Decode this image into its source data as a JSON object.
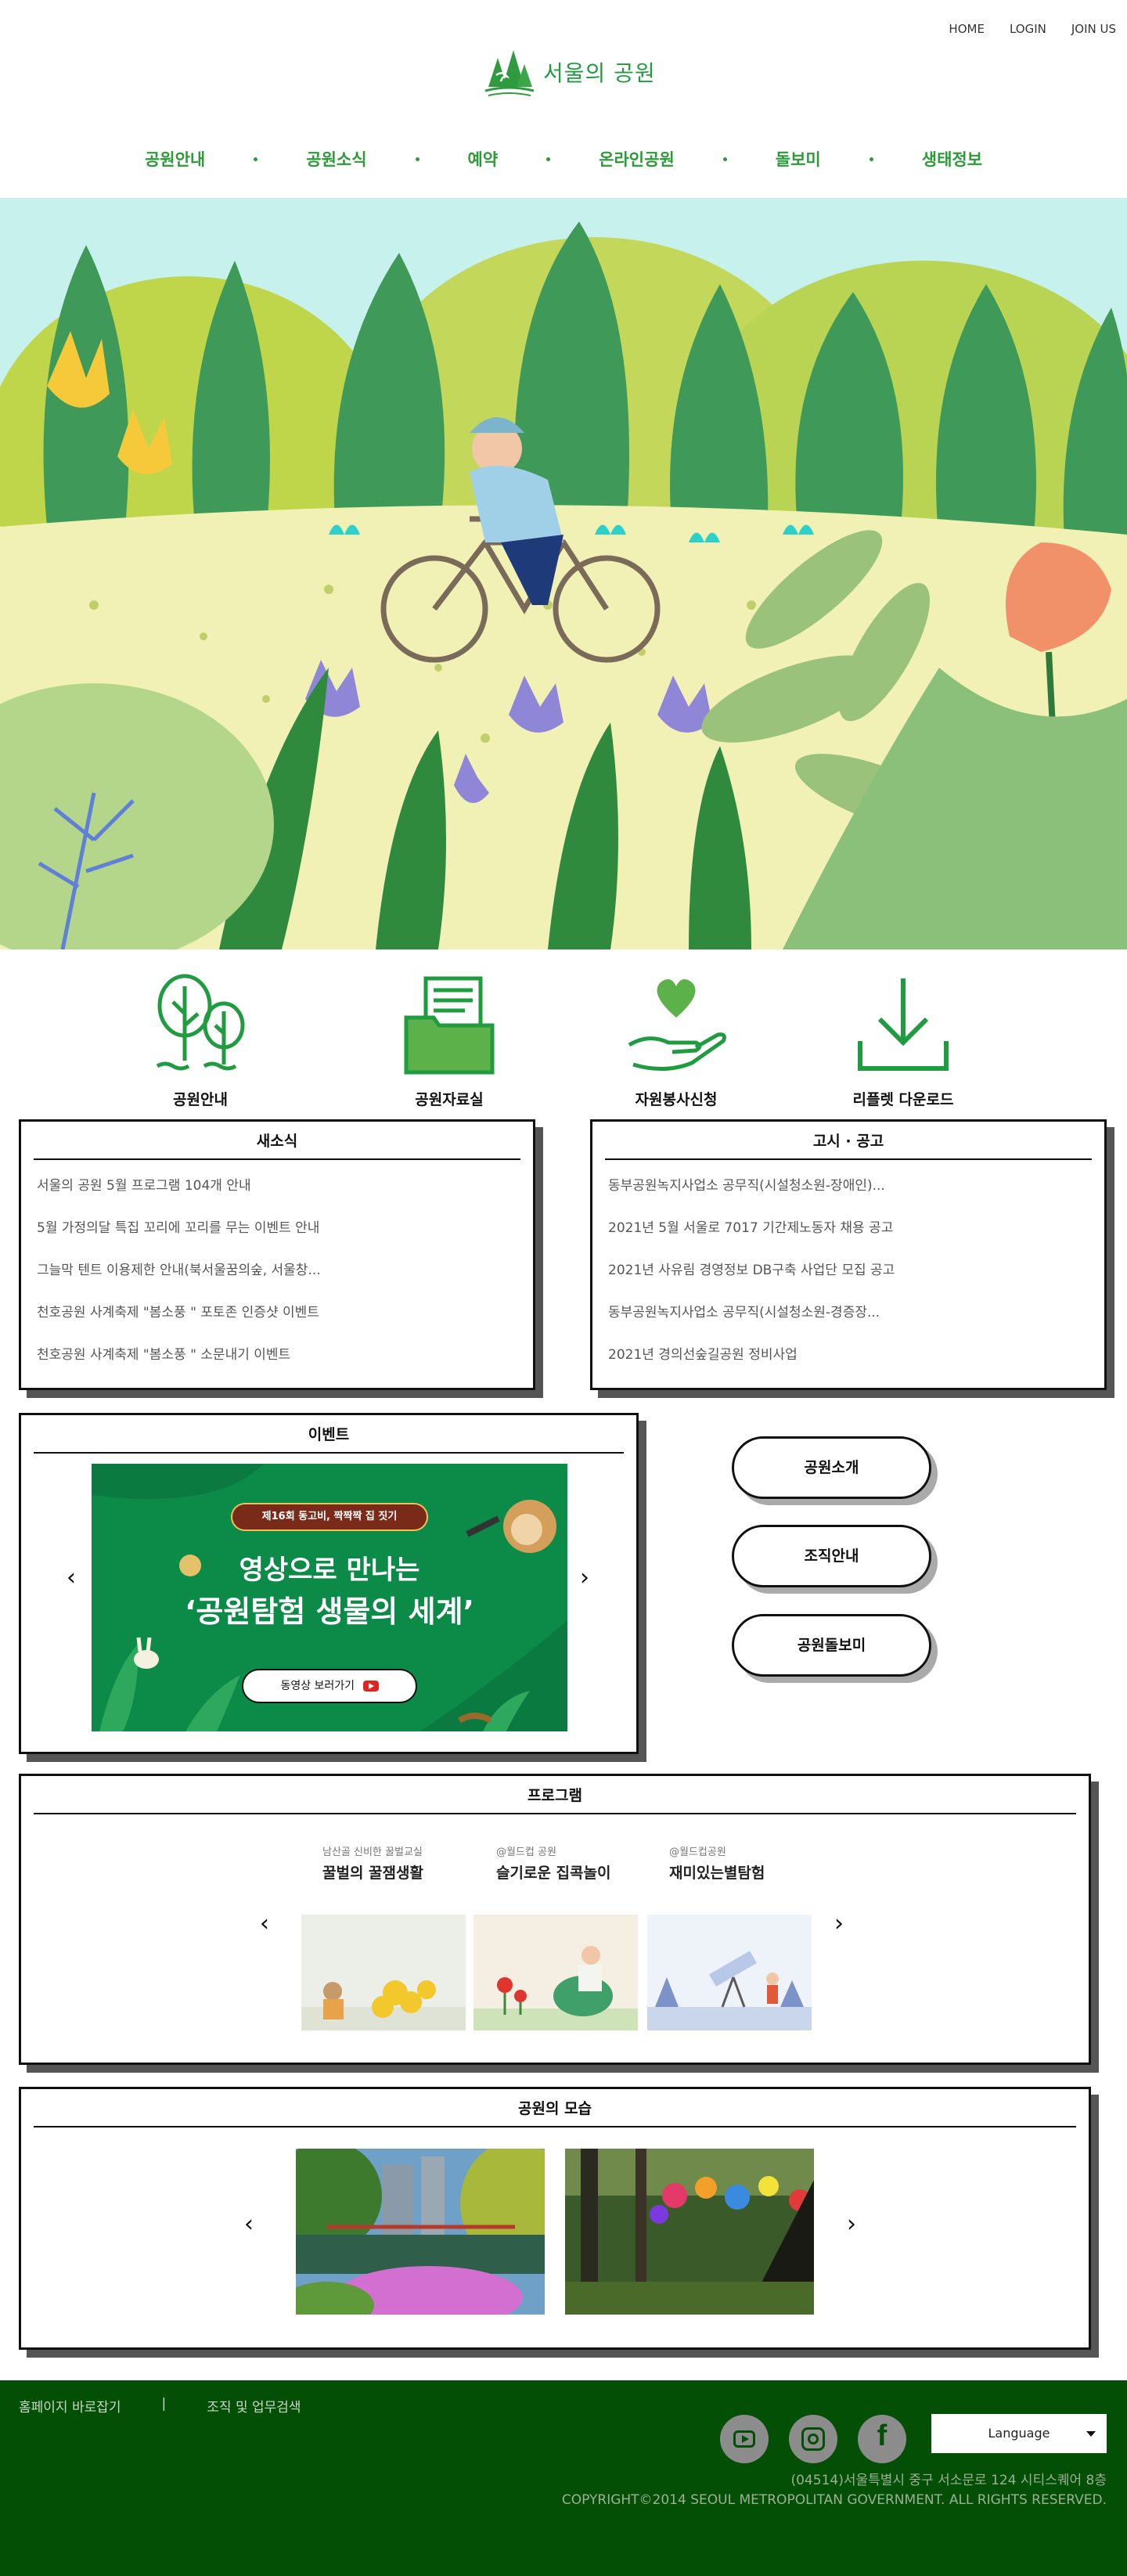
{
  "header": {
    "top_links": [
      "HOME",
      "LOGIN",
      "JOIN US"
    ],
    "logo_text": "서울의 공원",
    "nav": [
      "공원안내",
      "공원소식",
      "예약",
      "온라인공원",
      "돌보미",
      "생태정보"
    ]
  },
  "quick_links": [
    {
      "label": "공원안내",
      "icon": "trees-icon"
    },
    {
      "label": "공원자료실",
      "icon": "folder-icon"
    },
    {
      "label": "자원봉사신청",
      "icon": "heart-hand-icon"
    },
    {
      "label": "리플렛 다운로드",
      "icon": "download-icon"
    }
  ],
  "news": {
    "title": "새소식",
    "items": [
      "서울의 공원 5월 프로그램 104개 안내",
      "5월 가정의달 특집 꼬리에 꼬리를 무는 이벤트 안내",
      "그늘막 텐트 이용제한 안내(북서울꿈의숲, 서울창...",
      "천호공원 사계축제 \"봄소풍 \" 포토존 인증샷 이벤트",
      "천호공원 사계축제 \"봄소풍 \" 소문내기 이벤트"
    ]
  },
  "notice": {
    "title": "고시 · 공고",
    "items": [
      "동부공원녹지사업소 공무직(시설청소원-장애인)...",
      "2021년 5월 서울로 7017 기간제노동자 채용 공고",
      "2021년 사유림 경영정보 DB구축 사업단 모집 공고",
      "동부공원녹지사업소 공무직(시설청소원-경증장...",
      "2021년 경의선숲길공원 정비사업"
    ]
  },
  "event": {
    "title": "이벤트",
    "badge": "제16회 동고비, 짝짝짝 집 짓기",
    "headline_line1": "영상으로 만나는",
    "headline_line2": "‘공원탐험 생물의 세계’",
    "button": "동영상 보러가기",
    "colors": {
      "bg": "#0c8a48",
      "badge": "#7a2a18"
    }
  },
  "side_buttons": [
    "공원소개",
    "조직안내",
    "공원돌보미"
  ],
  "program": {
    "title": "프로그램",
    "cards": [
      {
        "sub": "남산골 신비한 꿀벌교실",
        "title": "꿀벌의 꿀잼생활"
      },
      {
        "sub": "@월드컵 공원",
        "title": "슬기로운 집콕놀이"
      },
      {
        "sub": "@월드컵공원",
        "title": "재미있는별탐험"
      }
    ]
  },
  "park_photos": {
    "title": "공원의 모습"
  },
  "footer": {
    "links": [
      "홈페이지 바로잡기",
      "|",
      "조직 및 업무검색"
    ],
    "language": "Language",
    "address": "(04514)서울특별시 중구 서소문로 124 시티스퀘어 8층",
    "copyright": "COPYRIGHT©2014 SEOUL METROPOLITAN GOVERNMENT. ALL RIGHTS RESERVED."
  },
  "colors": {
    "brand_green": "#2d9a3a",
    "footer_bg": "#034f05"
  }
}
